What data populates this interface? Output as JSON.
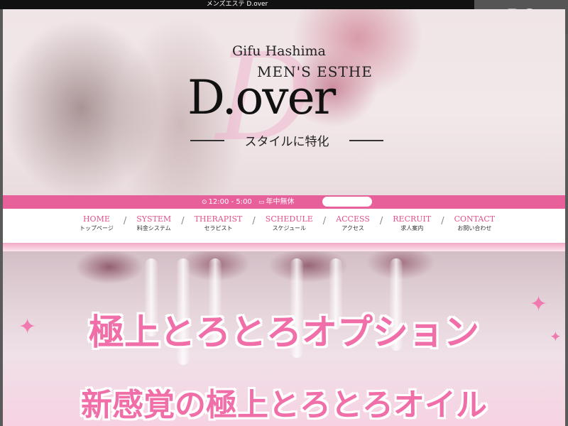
{
  "window": {
    "title": "メンズエステ D.over"
  },
  "badge": {
    "label": "PC"
  },
  "logo": {
    "line1": "Gifu Hashima",
    "line2": "MEN'S ESTHE",
    "name": "D.over",
    "tagline": "スタイルに特化",
    "watermark": "D"
  },
  "hours": {
    "clock_icon": "clock-icon",
    "time": "12:00 - 5:00",
    "calendar_icon": "calendar-icon",
    "days": "年中無休"
  },
  "nav": {
    "items": [
      {
        "en": "HOME",
        "jp": "トップページ"
      },
      {
        "en": "SYSTEM",
        "jp": "料金システム"
      },
      {
        "en": "THERAPIST",
        "jp": "セラピスト"
      },
      {
        "en": "SCHEDULE",
        "jp": "スケジュール"
      },
      {
        "en": "ACCESS",
        "jp": "アクセス"
      },
      {
        "en": "RECRUIT",
        "jp": "求人案内"
      },
      {
        "en": "CONTACT",
        "jp": "お問い合わせ"
      }
    ],
    "separator": "/"
  },
  "banner": {
    "title": "極上とろとろオプション",
    "subtitle": "新感覚の極上とろとろオイル"
  },
  "colors": {
    "accent": "#e8609a",
    "nav_text": "#e0528c",
    "banner_text": "#f06fa8"
  }
}
